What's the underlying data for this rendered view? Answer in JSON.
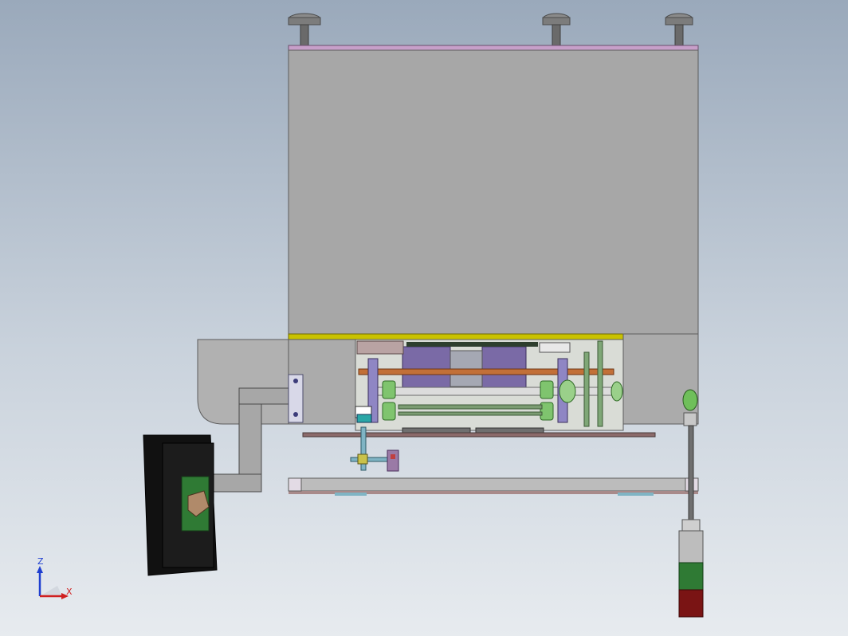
{
  "axis_triad": {
    "z_label": "Z",
    "x_label": "X",
    "z_color": "#1f3fd0",
    "x_color": "#d01f1f"
  },
  "colors": {
    "background_top": "#9aa9bb",
    "housing": "#a7a7a7",
    "housing_edge": "#5c5c5c",
    "top_trim": "#c79fc9",
    "yellow_strip": "#c9c200",
    "control_box": "#111111",
    "signal_green": "#2f7a34",
    "signal_red": "#7a1414",
    "copper_shaft": "#c27038",
    "purple_block": "#7a6aa6",
    "green_part": "#7fc46e"
  },
  "icons": {
    "triad": "xyz-axis-triad-icon"
  }
}
